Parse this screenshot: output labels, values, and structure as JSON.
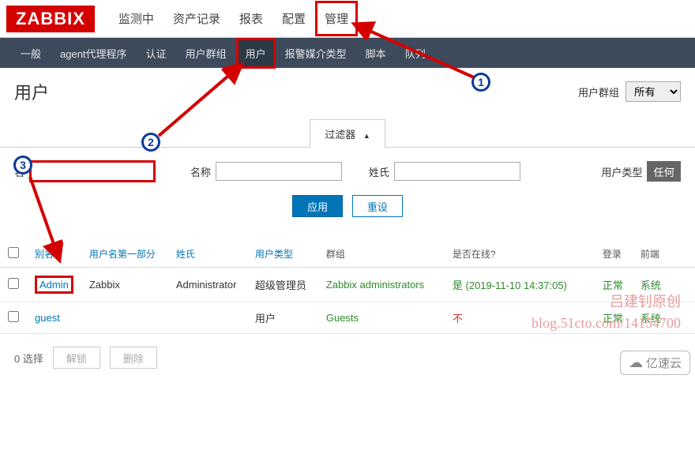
{
  "logo": "ZABBIX",
  "topnav": {
    "items": [
      "监测中",
      "资产记录",
      "报表",
      "配置",
      "管理"
    ],
    "active_index": 4
  },
  "subnav": {
    "items": [
      "一般",
      "agent代理程序",
      "认证",
      "用户群组",
      "用户",
      "报警媒介类型",
      "脚本",
      "队列"
    ],
    "active_index": 4
  },
  "page_title": "用户",
  "group_filter": {
    "label": "用户群组",
    "value": "所有"
  },
  "filter_tab": "过滤器",
  "filter": {
    "alias_label": "名",
    "alias_value": "",
    "name_label": "名称",
    "name_value": "",
    "surname_label": "姓氏",
    "surname_value": "",
    "type_label": "用户类型",
    "type_btn": "任何"
  },
  "buttons": {
    "apply": "应用",
    "reset": "重设"
  },
  "table": {
    "headers": {
      "alias": "别名",
      "name": "用户名第一部分",
      "surname": "姓氏",
      "type": "用户类型",
      "groups": "群组",
      "online": "是否在线?",
      "login": "登录",
      "frontend": "前端"
    },
    "rows": [
      {
        "alias": "Admin",
        "name": "Zabbix",
        "surname": "Administrator",
        "type": "超级管理员",
        "groups": "Zabbix administrators",
        "online": "是 (2019-11-10 14:37:05)",
        "online_class": "online-yes",
        "login": "正常",
        "frontend": "系统"
      },
      {
        "alias": "guest",
        "name": "",
        "surname": "",
        "type": "用户",
        "groups": "Guests",
        "online": "不",
        "online_class": "online-no",
        "login": "正常",
        "frontend": "系统"
      }
    ]
  },
  "footer": {
    "selected": "0 选择",
    "unlock": "解锁",
    "delete": "删除"
  },
  "annotations": {
    "badge1": "1",
    "badge2": "2",
    "badge3": "3"
  },
  "watermark": {
    "line1": "吕建钊原创",
    "line2": "blog.51cto.com/14154700"
  },
  "brand": "亿速云"
}
